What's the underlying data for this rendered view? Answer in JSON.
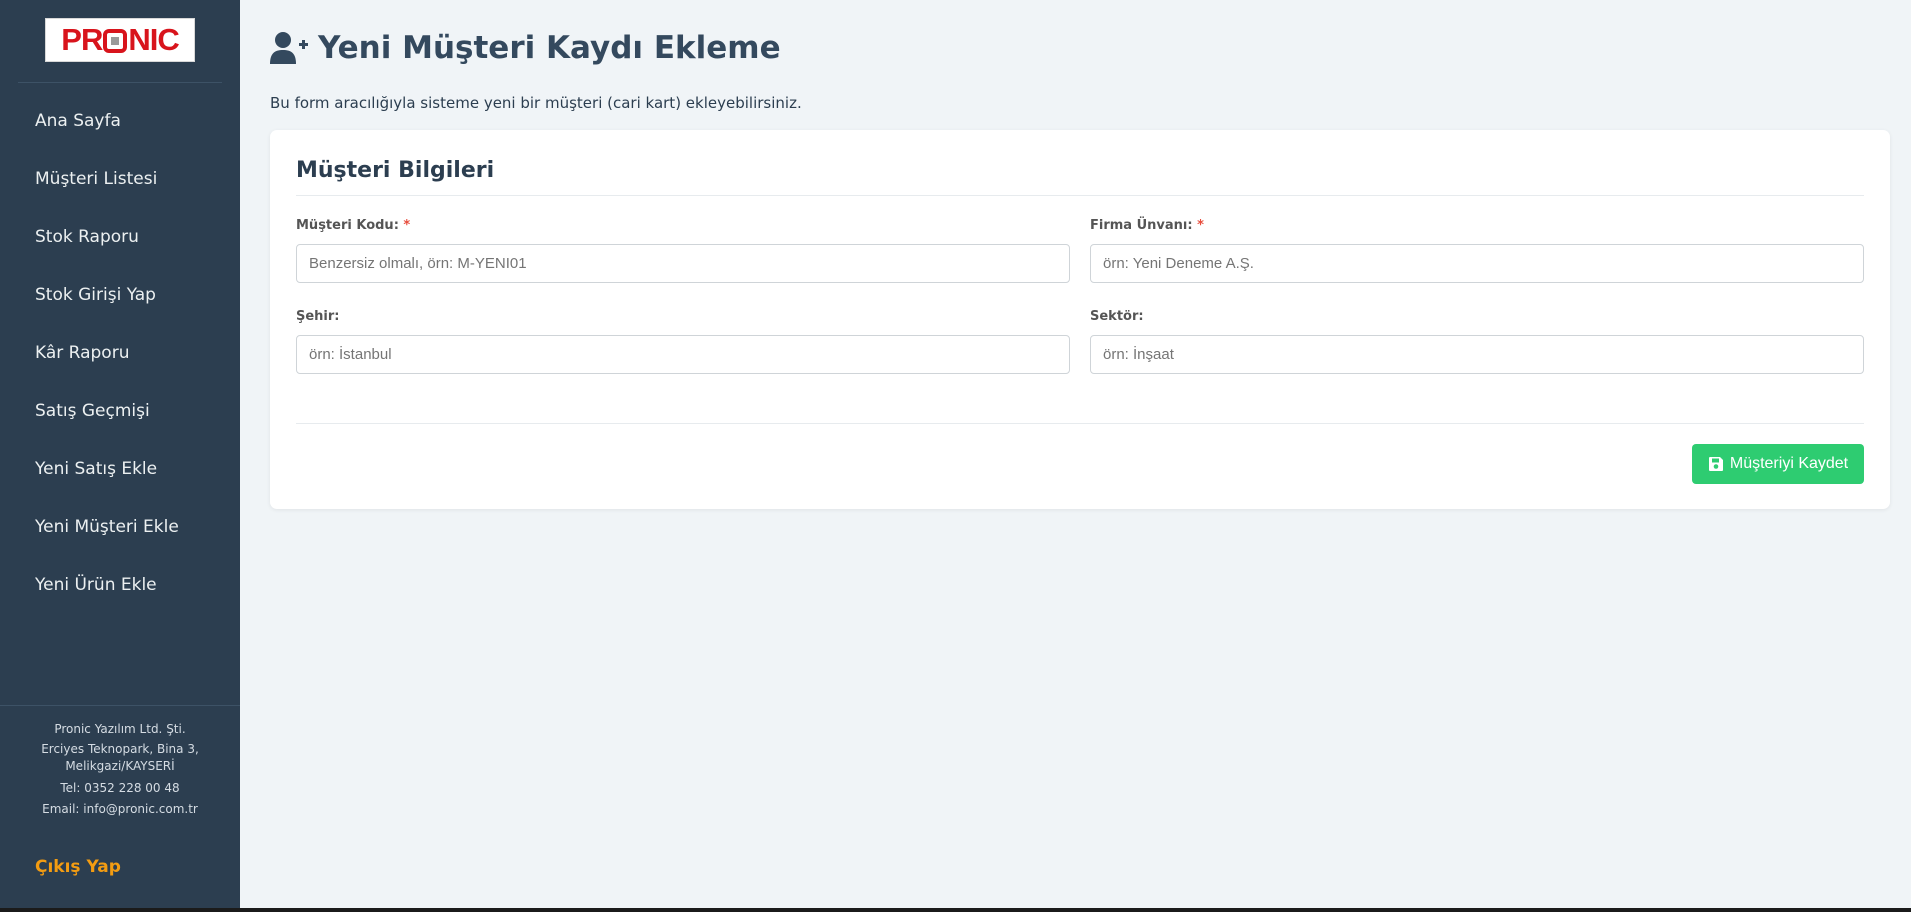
{
  "brand": {
    "logo_text": "PRONIC",
    "logo_color": "#d8141c"
  },
  "sidebar": {
    "items": [
      {
        "label": "Ana Sayfa"
      },
      {
        "label": "Müşteri Listesi"
      },
      {
        "label": "Stok Raporu"
      },
      {
        "label": "Stok Girişi Yap"
      },
      {
        "label": "Kâr Raporu"
      },
      {
        "label": "Satış Geçmişi"
      },
      {
        "label": "Yeni Satış Ekle"
      },
      {
        "label": "Yeni Müşteri Ekle"
      },
      {
        "label": "Yeni Ürün Ekle"
      }
    ],
    "footer": {
      "company": "Pronic Yazılım Ltd. Şti.",
      "address_line1": "Erciyes Teknopark, Bina 3,",
      "address_line2": "Melikgazi/KAYSERİ",
      "phone": "Tel: 0352 228 00 48",
      "email": "Email: info@pronic.com.tr"
    },
    "logout_label": "Çıkış Yap"
  },
  "page": {
    "title": "Yeni Müşteri Kaydı Ekleme",
    "title_icon": "user-plus-icon",
    "subtitle": "Bu form aracılığıyla sisteme yeni bir müşteri (cari kart) ekleyebilirsiniz."
  },
  "form": {
    "section_title": "Müşteri Bilgileri",
    "fields": {
      "customer_code": {
        "label": "Müşteri Kodu:",
        "required_mark": "*",
        "value": "",
        "placeholder": "Benzersiz olmalı, örn: M-YENI01"
      },
      "company_title": {
        "label": "Firma Ünvanı:",
        "required_mark": "*",
        "value": "",
        "placeholder": "örn: Yeni Deneme A.Ş."
      },
      "city": {
        "label": "Şehir:",
        "value": "",
        "placeholder": "örn: İstanbul"
      },
      "sector": {
        "label": "Sektör:",
        "value": "",
        "placeholder": "örn: İnşaat"
      }
    },
    "save_label": "Müşteriyi Kaydet",
    "save_icon": "save-icon"
  },
  "colors": {
    "sidebar_bg": "#2c3e50",
    "accent_green": "#2ecc71",
    "logout_orange": "#f39c12",
    "required_red": "#e74c3c",
    "page_bg": "#f0f4f7"
  }
}
